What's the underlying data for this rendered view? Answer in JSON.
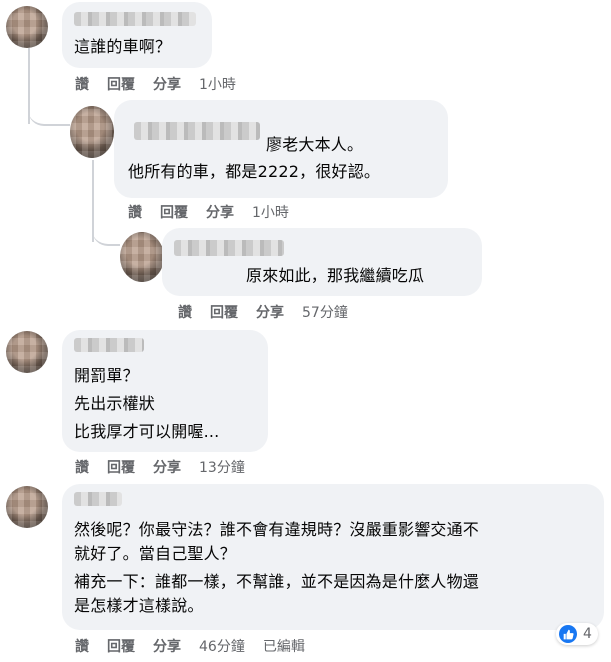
{
  "comments": [
    {
      "id": "c1",
      "lines": [
        "這誰的車啊？"
      ],
      "actions": {
        "like": "讚",
        "reply": "回覆",
        "share": "分享",
        "time": "1小時"
      }
    },
    {
      "id": "r1",
      "lines": [
        "廖老大本人。",
        "他所有的車，都是2222，很好認。"
      ],
      "actions": {
        "like": "讚",
        "reply": "回覆",
        "share": "分享",
        "time": "1小時"
      }
    },
    {
      "id": "r2",
      "lines": [
        "原來如此，那我繼續吃瓜"
      ],
      "actions": {
        "like": "讚",
        "reply": "回覆",
        "share": "分享",
        "time": "57分鐘"
      }
    },
    {
      "id": "c2",
      "lines": [
        "開罰單？",
        "先出示權狀",
        "比我厚才可以開喔..."
      ],
      "actions": {
        "like": "讚",
        "reply": "回覆",
        "share": "分享",
        "time": "13分鐘"
      }
    },
    {
      "id": "c3",
      "lines": [
        "然後呢？你最守法？誰不會有違規時？沒嚴重影響交通不",
        "就好了。當自己聖人？",
        "補充一下：誰都一樣，不幫誰，並不是因為是什麼人物還",
        "是怎樣才這樣說。"
      ],
      "actions": {
        "like": "讚",
        "reply": "回覆",
        "share": "分享",
        "time": "46分鐘",
        "edited": "已編輯"
      },
      "reaction": {
        "icon": "thumbs-up-icon",
        "count": "4",
        "color": "#1877f2"
      }
    }
  ]
}
